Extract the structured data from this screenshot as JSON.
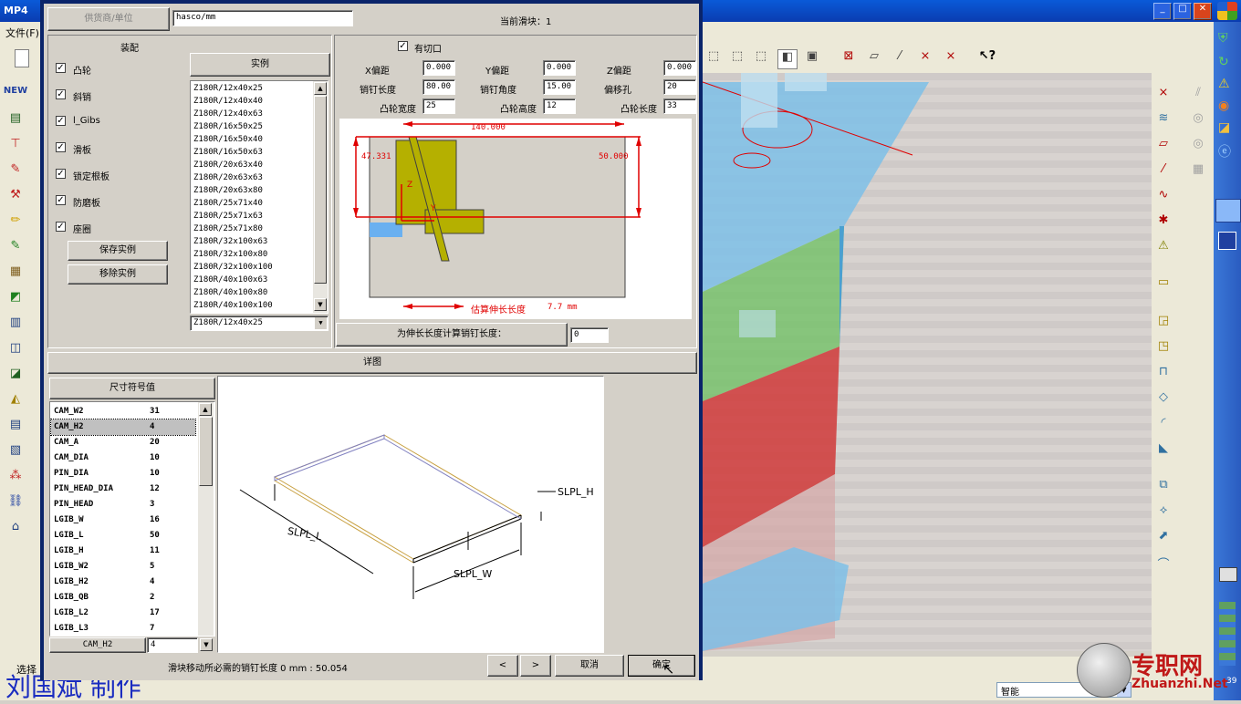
{
  "app": {
    "title_partial": "MP4",
    "menu_file": "文件(F)",
    "select_label": "选择",
    "status_mode": "智能",
    "corner_num": "39"
  },
  "watermark": {
    "author": "刘国斌  制作",
    "site_cn": "专职网",
    "site_url": "Zhuanzhi.Net"
  },
  "window_controls": {
    "minimize": "_",
    "maximize": "□",
    "close": "✕"
  },
  "dialog": {
    "supplier_button": "供货商/单位",
    "supplier_value": "hasco/mm",
    "current_slider": "当前滑块：1",
    "assembly_title": "装配",
    "assembly_items": [
      "凸轮",
      "斜销",
      "l_Gibs",
      "滑板",
      "锁定根板",
      "防磨板",
      "座圈"
    ],
    "save_instance": "保存实例",
    "remove_instance": "移除实例",
    "instance_button": "实例",
    "instances": [
      "Z180R/12x40x25",
      "Z180R/12x40x40",
      "Z180R/12x40x63",
      "Z180R/16x50x25",
      "Z180R/16x50x40",
      "Z180R/16x50x63",
      "Z180R/20x63x40",
      "Z180R/20x63x63",
      "Z180R/20x63x80",
      "Z180R/25x71x40",
      "Z180R/25x71x63",
      "Z180R/25x71x80",
      "Z180R/32x100x63",
      "Z180R/32x100x80",
      "Z180R/32x100x100",
      "Z180R/40x100x63",
      "Z180R/40x100x80",
      "Z180R/40x100x100"
    ],
    "instance_selected": "Z180R/12x40x25",
    "cutout_label": "有切口",
    "params": {
      "x_offset_label": "X偏距",
      "x_offset": "0.000",
      "y_offset_label": "Y偏距",
      "y_offset": "0.000",
      "z_offset_label": "Z偏距",
      "z_offset": "0.000",
      "pin_length_label": "销钉长度",
      "pin_length": "80.00",
      "pin_angle_label": "销钉角度",
      "pin_angle": "15.00",
      "offset_hole_label": "偏移孔",
      "offset_hole": "20",
      "cam_width_label": "凸轮宽度",
      "cam_width": "25",
      "cam_height_label": "凸轮高度",
      "cam_height": "12",
      "cam_length_label": "凸轮长度",
      "cam_length": "33"
    },
    "preview": {
      "dim_top": "140.000",
      "dim_left": "47.331",
      "dim_right": "50.000",
      "axis_z": "Z",
      "axis_y": "Y",
      "est_label": "估算伸长长度",
      "est_value": "7.7 mm"
    },
    "calc_button": "为伸长长度计算销钉长度：",
    "calc_value": "0",
    "detail_header": "详图",
    "symbol_header": "尺寸符号值",
    "symbols": [
      {
        "name": "CAM_W2",
        "value": "31"
      },
      {
        "name": "CAM_H2",
        "value": "4"
      },
      {
        "name": "CAM_A",
        "value": "20"
      },
      {
        "name": "CAM_DIA",
        "value": "10"
      },
      {
        "name": "PIN_DIA",
        "value": "10"
      },
      {
        "name": "PIN_HEAD_DIA",
        "value": "12"
      },
      {
        "name": "PIN_HEAD",
        "value": "3"
      },
      {
        "name": "LGIB_W",
        "value": "16"
      },
      {
        "name": "LGIB_L",
        "value": "50"
      },
      {
        "name": "LGIB_H",
        "value": "11"
      },
      {
        "name": "LGIB_W2",
        "value": "5"
      },
      {
        "name": "LGIB_H2",
        "value": "4"
      },
      {
        "name": "LGIB_QB",
        "value": "2"
      },
      {
        "name": "LGIB_L2",
        "value": "17"
      },
      {
        "name": "LGIB_L3",
        "value": "7"
      }
    ],
    "edit_name": "CAM_H2",
    "edit_value": "4",
    "drawing": {
      "slpl_h": "SLPL_H",
      "slpl_l": "SLPL_L",
      "slpl_w": "SLPL_W"
    },
    "status_text": "滑块移动所必需的销钉长度 0 mm : 50.054",
    "prev": "<",
    "next": ">",
    "cancel": "取消",
    "ok": "确定"
  },
  "colors": {
    "accent": "#0a246a",
    "preview_red": "#e00000",
    "cam_yellow": "#b5b000",
    "mold_blue": "#7ec0e8",
    "mold_green": "#6cc060",
    "mold_red": "#d03030"
  }
}
